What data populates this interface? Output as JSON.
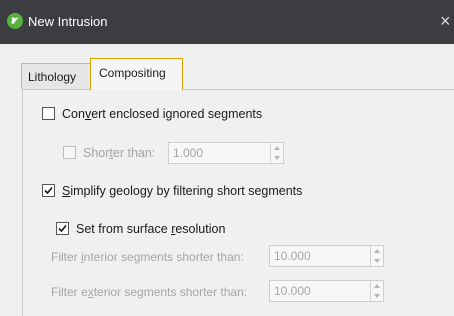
{
  "window": {
    "title": "New Intrusion",
    "close_glyph": "×"
  },
  "tabs": [
    {
      "label": "Lithology",
      "active": false
    },
    {
      "label": "Compositing",
      "active": true
    }
  ],
  "convert_enclosed": {
    "label_before": "Con",
    "mnemonic": "v",
    "label_after": "ert enclosed ignored segments",
    "checked": false,
    "shorter_than": {
      "label_before": "Shor",
      "mnemonic": "t",
      "label_after": "er than:",
      "checked": false,
      "value": "1.000"
    }
  },
  "simplify_geology": {
    "label_before": "",
    "mnemonic": "S",
    "label_after": "implify geology by filtering short segments",
    "checked": true,
    "set_from_surface": {
      "label_before": "Set from surface ",
      "mnemonic": "r",
      "label_after": "esolution",
      "checked": true
    },
    "filter_interior": {
      "label_before": "Filter ",
      "mnemonic": "i",
      "label_after": "nterior segments shorter than:",
      "value": "10.000"
    },
    "filter_exterior": {
      "label_before": "Filter e",
      "mnemonic": "x",
      "label_after": "terior segments shorter than:",
      "value": "10.000"
    }
  },
  "colors": {
    "titlebar": "#3c3d41",
    "active_tab_border": "#d6a200",
    "app_icon": "#58b13f"
  }
}
